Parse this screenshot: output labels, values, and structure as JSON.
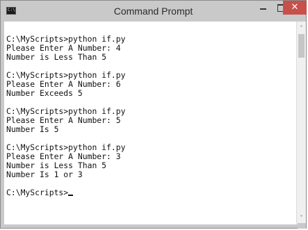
{
  "window": {
    "title": "Command Prompt",
    "app_icon": "cmd-icon",
    "icon_glyph": "C:\\",
    "controls": {
      "minimize_icon": "minimize-icon",
      "maximize_icon": "maximize-icon",
      "close_icon": "close-icon",
      "close_glyph": "✕",
      "close_color": "#c7504a"
    }
  },
  "console": {
    "background": "#ffffff",
    "text_color": "#111111",
    "lines": [
      "C:\\MyScripts>python if.py",
      "Please Enter A Number: 4",
      "Number is Less Than 5",
      "",
      "C:\\MyScripts>python if.py",
      "Please Enter A Number: 6",
      "Number Exceeds 5",
      "",
      "C:\\MyScripts>python if.py",
      "Please Enter A Number: 5",
      "Number Is 5",
      "",
      "C:\\MyScripts>python if.py",
      "Please Enter A Number: 3",
      "Number is Less Than 5",
      "Number Is 1 or 3",
      "",
      "C:\\MyScripts>"
    ]
  },
  "scrollbar": {
    "up_arrow": "˄",
    "down_arrow": "˅",
    "up_icon": "scroll-up-arrow-icon",
    "down_icon": "scroll-down-arrow-icon"
  }
}
